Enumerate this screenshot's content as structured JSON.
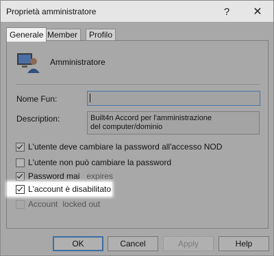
{
  "window": {
    "title": "Proprietà amministratore",
    "help_glyph": "?",
    "close_glyph": "✕"
  },
  "tabs": [
    {
      "label": "Generale",
      "active": true
    },
    {
      "label": "Member Of",
      "active": false
    },
    {
      "label": "Profilo",
      "active": false
    }
  ],
  "user": {
    "name": "Amministratore",
    "icon": "user-computer-icon"
  },
  "fields": {
    "nome_fun_label": "Nome Fun:",
    "nome_fun_value": "",
    "description_label": "Description:",
    "description_line1": "Built4n Accord per l'amministrazione",
    "description_line2": "del computer/dominio"
  },
  "checkboxes": [
    {
      "label": "L'utente deve cambiare la password all'accesso NOD",
      "checked": true,
      "enabled": true
    },
    {
      "label": "L'utente non può cambiare la password",
      "checked": false,
      "enabled": true
    },
    {
      "label": "Password mai",
      "label2": "expires",
      "checked": true,
      "enabled": true
    },
    {
      "label": "L'account è disabilitato",
      "checked": true,
      "enabled": true,
      "highlighted": true
    },
    {
      "label": "Account",
      "label2": "locked out",
      "checked": false,
      "enabled": false
    }
  ],
  "buttons": {
    "ok": "OK",
    "cancel": "Cancel",
    "apply": "Apply",
    "help": "Help"
  }
}
